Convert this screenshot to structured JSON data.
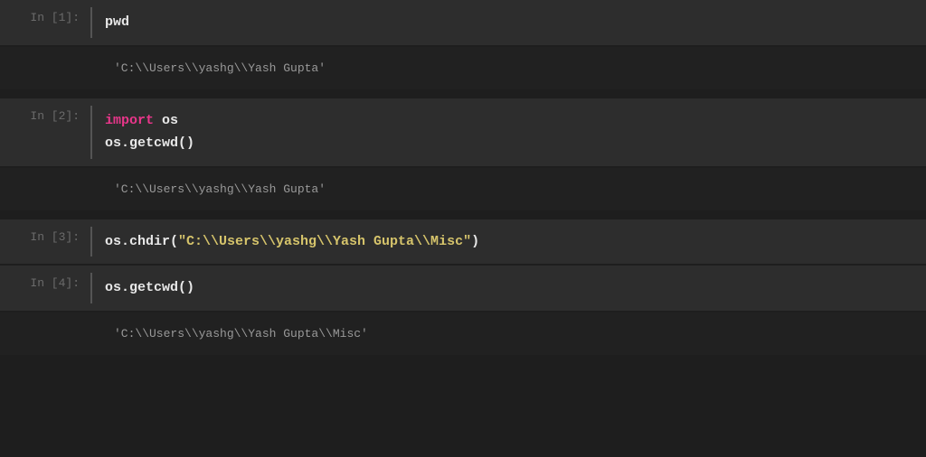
{
  "cells": [
    {
      "prompt": "In [1]:",
      "input_plain": "pwd",
      "output": "'C:\\\\Users\\\\yashg\\\\Yash Gupta'"
    },
    {
      "prompt": "In [2]:",
      "line1_kw": "import",
      "line1_mod": " os",
      "line2": "os.getcwd()",
      "output": "'C:\\\\Users\\\\yashg\\\\Yash Gupta'"
    },
    {
      "prompt": "In [3]:",
      "call_pre": "os.chdir(",
      "call_str": "\"C:\\\\Users\\\\yashg\\\\Yash Gupta\\\\Misc\"",
      "call_post": ")"
    },
    {
      "prompt": "In [4]:",
      "input_plain": "os.getcwd()",
      "output": "'C:\\\\Users\\\\yashg\\\\Yash Gupta\\\\Misc'"
    }
  ]
}
